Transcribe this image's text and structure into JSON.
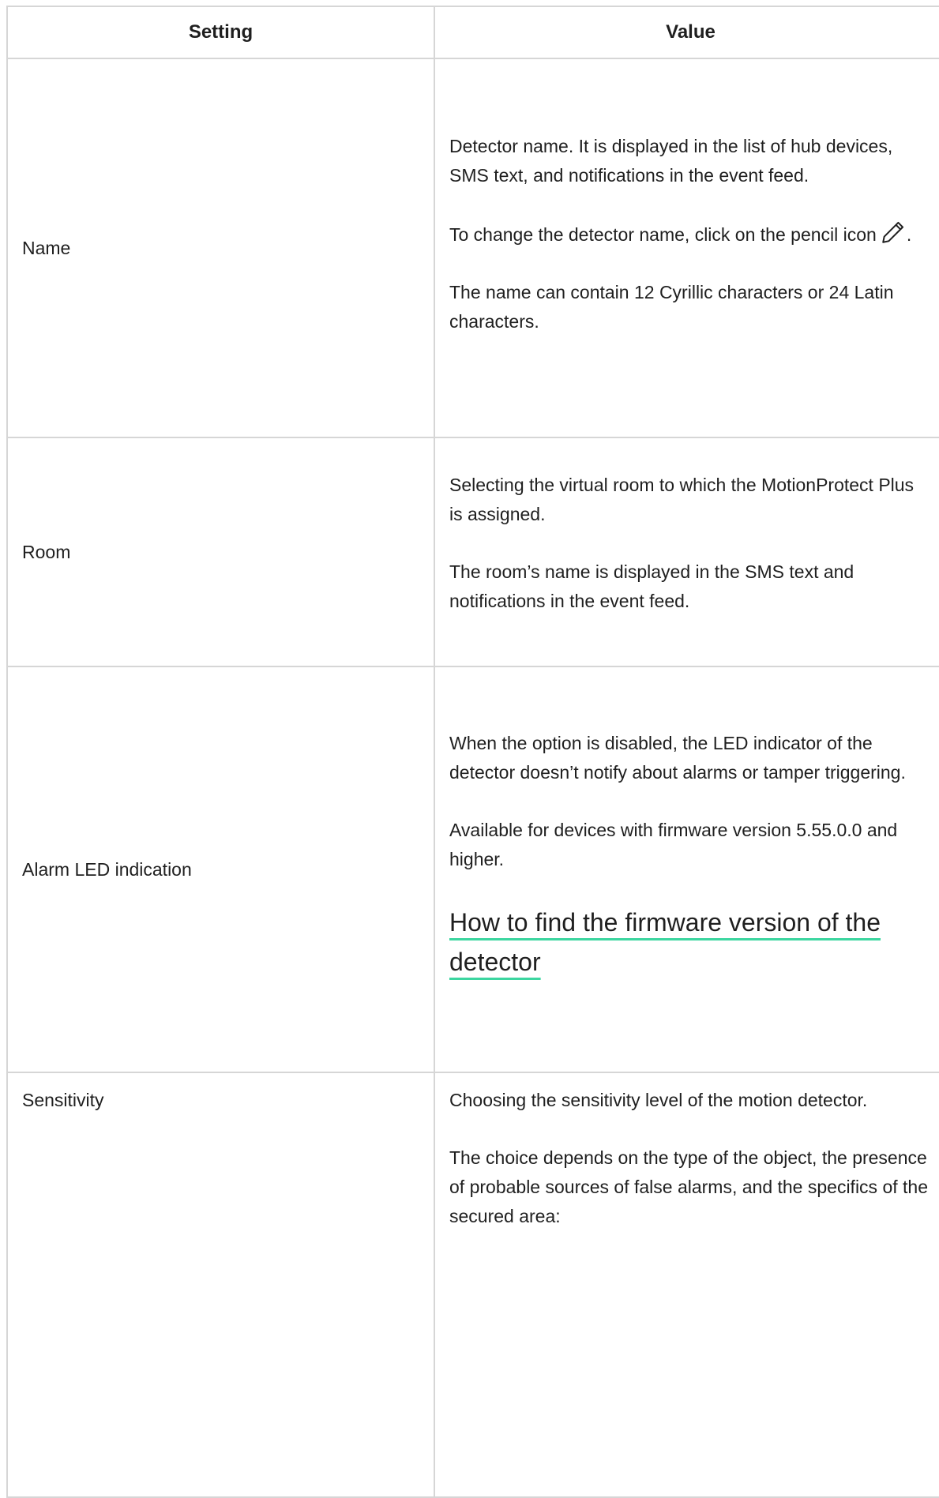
{
  "table": {
    "headers": {
      "setting": "Setting",
      "value": "Value"
    },
    "rows": [
      {
        "setting": "Name",
        "paragraphs": [
          "Detector name. It is displayed in the list of hub devices, SMS text, and notifications in the event feed.",
          "To change the detector name, click on the pencil icon",
          "The name can contain 12 Cyrillic characters or 24 Latin characters."
        ],
        "pencil_suffix": "."
      },
      {
        "setting": "Room",
        "paragraphs": [
          "Selecting the virtual room to which the MotionProtect Plus is assigned.",
          "The room’s name is displayed in the SMS text and notifications in the event feed."
        ]
      },
      {
        "setting": "Alarm LED indication",
        "paragraphs": [
          "When the option is disabled, the LED indicator of the detector doesn’t notify about alarms or tamper triggering.",
          "Available for devices with firmware version 5.55.0.0 and higher."
        ],
        "link": "How to find the firmware version of the detector"
      },
      {
        "setting": "Sensitivity",
        "paragraphs": [
          "Choosing the sensitivity level of the motion detector.",
          "The choice depends on the type of the object, the presence of probable sources of false alarms, and the specifics of the secured area:"
        ]
      }
    ]
  },
  "icons": {
    "pencil": "pencil-icon"
  },
  "colors": {
    "border": "#d6d6d6",
    "text": "#1f1f1f",
    "link_underline": "#3cd6a0"
  }
}
